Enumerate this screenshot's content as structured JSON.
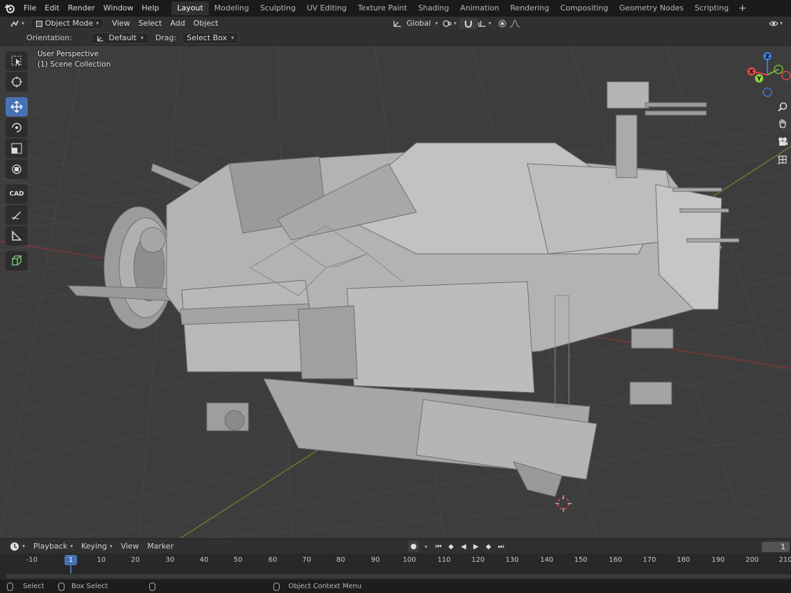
{
  "menubar": {
    "items": [
      "File",
      "Edit",
      "Render",
      "Window",
      "Help"
    ],
    "workspaces": [
      "Layout",
      "Modeling",
      "Sculpting",
      "UV Editing",
      "Texture Paint",
      "Shading",
      "Animation",
      "Rendering",
      "Compositing",
      "Geometry Nodes",
      "Scripting"
    ],
    "active_workspace": "Layout",
    "add_label": "+"
  },
  "viewport_header": {
    "mode": "Object Mode",
    "menus": [
      "View",
      "Select",
      "Add",
      "Object"
    ],
    "transform_orientation": "Global"
  },
  "tool_settings": {
    "orientation_label": "Orientation:",
    "orientation_value": "Default",
    "drag_label": "Drag:",
    "drag_value": "Select Box"
  },
  "viewport": {
    "perspective": "User Perspective",
    "collection": "(1) Scene Collection",
    "gizmo_axes": {
      "x": "X",
      "y": "Y",
      "z": "Z"
    },
    "cad_label": "CAD",
    "colors": {
      "background": "#3d3d3d",
      "grid": "#4a4a4a",
      "x_axis": "#9a3a3a",
      "y_axis": "#6a8f2a",
      "model": "#a8a8a8"
    }
  },
  "timeline": {
    "menus": [
      "Playback",
      "Keying",
      "View",
      "Marker"
    ],
    "current_frame": "1",
    "frame_field": "1",
    "ticks": [
      "-10",
      "10",
      "20",
      "30",
      "40",
      "50",
      "60",
      "70",
      "80",
      "90",
      "100",
      "110",
      "120",
      "130",
      "140",
      "150",
      "160",
      "170",
      "180",
      "190",
      "200",
      "210"
    ]
  },
  "statusbar": {
    "select": "Select",
    "box_select": "Box Select",
    "context_menu": "Object Context Menu"
  }
}
